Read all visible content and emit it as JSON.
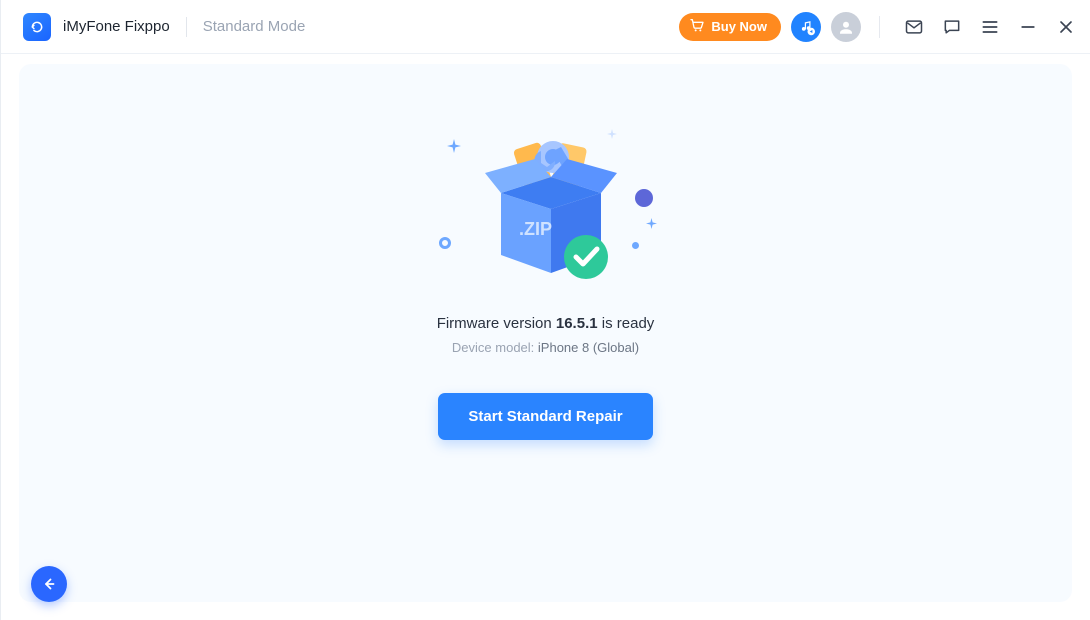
{
  "header": {
    "app_name": "iMyFone Fixppo",
    "mode_label": "Standard Mode",
    "buy_label": "Buy Now"
  },
  "main": {
    "firmware_prefix": "Firmware version ",
    "firmware_version": "16.5.1",
    "firmware_suffix": " is ready",
    "device_model_label": "Device model: ",
    "device_model_value": "iPhone 8 (Global)",
    "primary_button": "Start Standard Repair",
    "box_label": ".ZIP"
  }
}
